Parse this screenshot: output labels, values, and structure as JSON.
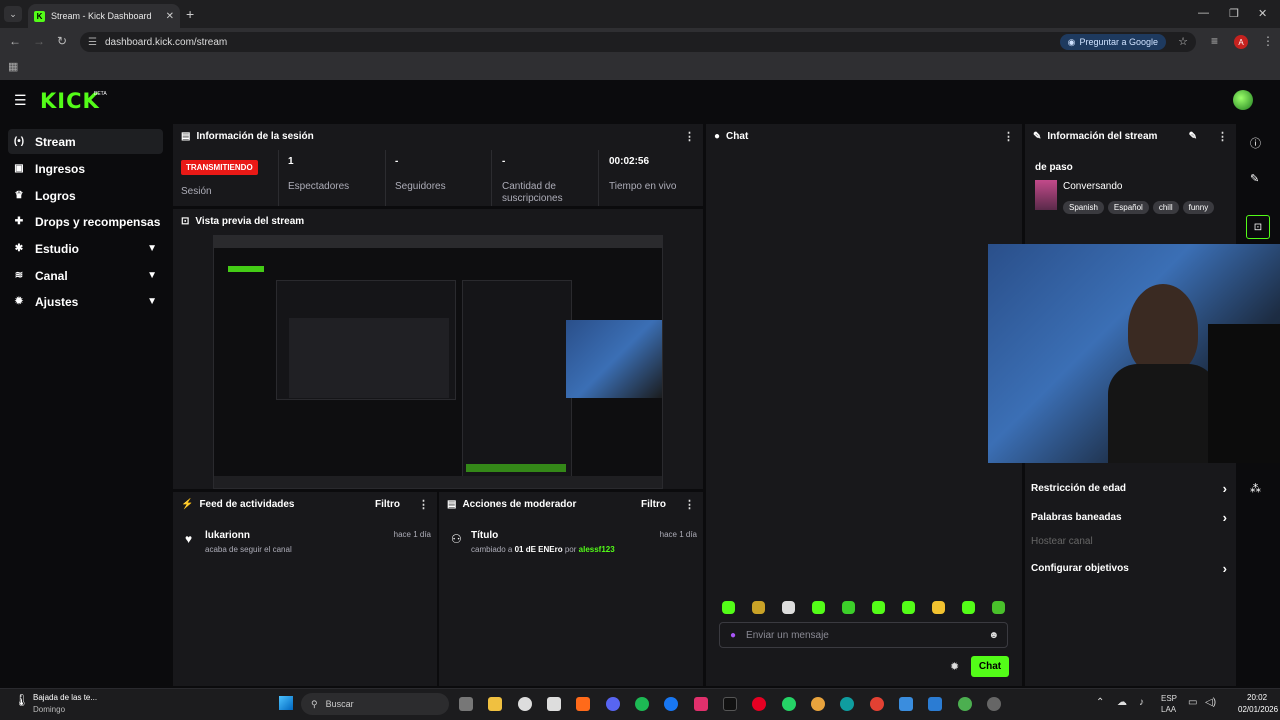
{
  "browser": {
    "tab_title": "Stream - Kick Dashboard",
    "url": "dashboard.kick.com/stream",
    "ask_google": "Preguntar a Google",
    "avatar_letter": "A"
  },
  "header": {
    "logo": "KICK",
    "beta": "BETA"
  },
  "sidebar": {
    "items": [
      {
        "label": "Stream",
        "icon": "broadcast-icon",
        "active": true
      },
      {
        "label": "Ingresos",
        "icon": "money-icon"
      },
      {
        "label": "Logros",
        "icon": "trophy-icon"
      },
      {
        "label": "Drops y recompensas",
        "icon": "gift-icon"
      },
      {
        "label": "Estudio",
        "icon": "palette-icon",
        "expandable": true
      },
      {
        "label": "Canal",
        "icon": "channel-icon",
        "expandable": true
      },
      {
        "label": "Ajustes",
        "icon": "gear-icon",
        "expandable": true
      }
    ]
  },
  "session": {
    "title": "Información de la sesión",
    "live_badge": "TRANSMITIENDO",
    "stats": [
      {
        "value": "",
        "label": "Sesión"
      },
      {
        "value": "1",
        "label": "Espectadores"
      },
      {
        "value": "-",
        "label": "Seguidores"
      },
      {
        "value": "-",
        "label": "Cantidad de suscripciones"
      },
      {
        "value": "00:02:56",
        "label": "Tiempo en vivo"
      }
    ]
  },
  "preview": {
    "title": "Vista previa del stream"
  },
  "feed": {
    "title": "Feed de actividades",
    "filter": "Filtro",
    "item": {
      "name": "lukarionn",
      "sub": "acaba de seguir el canal",
      "time": "hace 1 día"
    }
  },
  "mod": {
    "title": "Acciones de moderador",
    "filter": "Filtro",
    "item": {
      "name": "Título",
      "sub_prefix": "cambiado a",
      "sub_value": "01 dE ENEro",
      "sub_by": "por",
      "sub_user": "alessf123",
      "time": "hace 1 día"
    }
  },
  "chat": {
    "title": "Chat",
    "placeholder": "Enviar un mensaje",
    "send": "Chat"
  },
  "stream_info": {
    "title": "Información del stream",
    "subtitle": "de paso",
    "category": "Conversando",
    "tags": [
      "Spanish",
      "Español",
      "chill",
      "funny"
    ],
    "options": [
      {
        "label": "Restricción de edad",
        "enabled": true
      },
      {
        "label": "Palabras baneadas",
        "enabled": true
      },
      {
        "label": "Hostear canal",
        "enabled": false
      },
      {
        "label": "Configurar objetivos",
        "enabled": true
      }
    ]
  },
  "taskbar": {
    "weather_title": "Bajada de las te...",
    "weather_sub": "Domingo",
    "search": "Buscar",
    "lang1": "ESP",
    "lang2": "LAA",
    "time": "20:02",
    "date": "02/01/2026"
  },
  "colors": {
    "accent": "#53fc18",
    "live": "#e91916",
    "panel": "#18181b",
    "bg": "#0b0b0d"
  }
}
